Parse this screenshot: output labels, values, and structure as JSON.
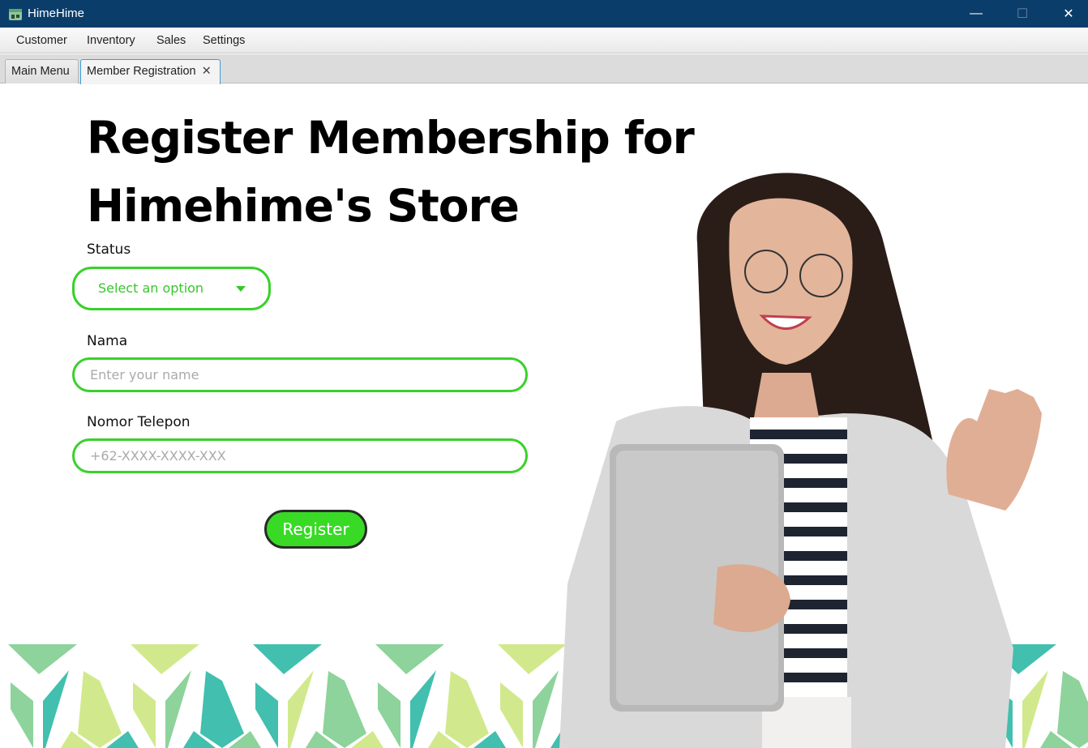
{
  "window": {
    "title": "HimeHime",
    "minimize": "—",
    "maximize": "☐",
    "close": "✕"
  },
  "menu": [
    "Customer",
    "Inventory",
    "Sales",
    "Settings"
  ],
  "tabs": [
    {
      "label": "Main Menu"
    },
    {
      "label": "Member Registration",
      "close": "✕"
    }
  ],
  "form": {
    "heading_line1": "Register Membership for",
    "heading_line2": "Himehime's Store",
    "status_label": "Status",
    "status_value": "Select an option",
    "name_label": "Nama",
    "name_placeholder": "Enter your name",
    "phone_label": "Nomor Telepon",
    "phone_placeholder": "+62-XXXX-XXXX-XXX",
    "register_label": "Register"
  },
  "colors": {
    "accent": "#3ad12b",
    "titlebar": "#0b3d6b"
  }
}
